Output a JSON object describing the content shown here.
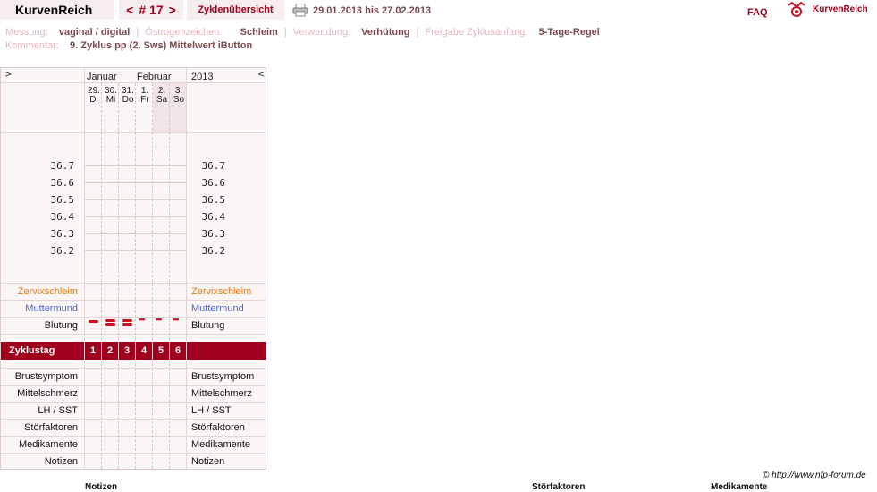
{
  "header": {
    "brand": "KurvenReich",
    "nav_prev": "<",
    "cycle_number": "# 17",
    "nav_next": ">",
    "overview": "Zyklenübersicht",
    "date_range": "29.01.2013 bis 27.02.2013",
    "faq": "FAQ",
    "logo_text": "KurvenReich"
  },
  "meta": {
    "messung_label": "Messung:",
    "messung_value": "vaginal / digital",
    "oestrogen_label": "Östrogenzeichen:",
    "oestrogen_value": "Schleim",
    "verwendung_label": "Verwendung:",
    "verwendung_value": "Verhütung",
    "freigabe_label": "Freigabe Zyklusanfang:",
    "freigabe_value": "5-Tage-Regel",
    "kommentar_label": "Kommentar:",
    "kommentar_value": "9. Zyklus pp (2. Sws) Mittelwert iButton"
  },
  "chart": {
    "nav_left": ">",
    "nav_right": "<",
    "month1": "Januar",
    "month2": "Februar",
    "year": "2013",
    "days": [
      {
        "d": "29.",
        "w": "Di"
      },
      {
        "d": "30.",
        "w": "Mi"
      },
      {
        "d": "31.",
        "w": "Do"
      },
      {
        "d": "1.",
        "w": "Fr"
      },
      {
        "d": "2.",
        "w": "Sa"
      },
      {
        "d": "3.",
        "w": "So"
      }
    ],
    "temps": [
      "36.7",
      "36.6",
      "36.5",
      "36.4",
      "36.3",
      "36.2"
    ],
    "rows": {
      "zervix": "Zervixschleim",
      "muttermund": "Muttermund",
      "blutung": "Blutung",
      "zyklustag": "Zyklustag",
      "brust": "Brustsymptom",
      "mittel": "Mittelschmerz",
      "lh": "LH / SST",
      "stoer": "Störfaktoren",
      "medi": "Medikamente",
      "notizen": "Notizen"
    },
    "cycle_days": [
      "1",
      "2",
      "3",
      "4",
      "5",
      "6"
    ],
    "bleeding": [
      "heavy-1",
      "heavy-2",
      "heavy-2",
      "light",
      "light",
      "light"
    ]
  },
  "footer": {
    "copyright": "© http://www.nfp-forum.de",
    "notizen": "Notizen",
    "stoerfaktoren": "Störfaktoren",
    "medikamente": "Medikamente"
  },
  "colors": {
    "accent": "#a0001e",
    "tab_bg": "#f6eeee",
    "zervix": "#e07a10",
    "muttermund": "#4e64c8"
  }
}
